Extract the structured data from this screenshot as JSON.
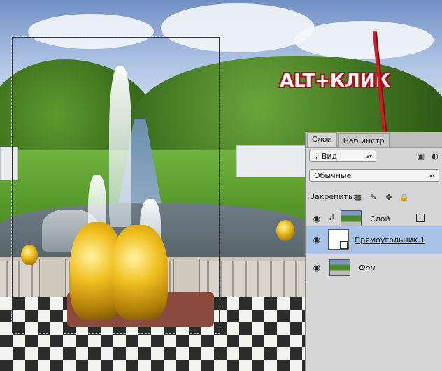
{
  "callout": {
    "text": "ALT+КЛИК"
  },
  "layers_panel": {
    "tabs": [
      {
        "label": "Слои",
        "active": true
      },
      {
        "label": "Наб.инстр",
        "active": false
      }
    ],
    "filter": {
      "label": "Вид"
    },
    "blend_mode": {
      "value": "Обычные"
    },
    "lock_label": "Закрепить:",
    "layers": [
      {
        "name": "Слой",
        "visible": true,
        "selected": false,
        "clipped": true
      },
      {
        "name": "Прямоугольник 1",
        "visible": true,
        "selected": true,
        "clipped": false
      },
      {
        "name": "Фон",
        "visible": true,
        "selected": false,
        "clipped": false
      }
    ]
  },
  "colors": {
    "callout_red": "#b0101a",
    "arrow_red": "#c0141f",
    "selected_layer": "#a7c3e8"
  }
}
